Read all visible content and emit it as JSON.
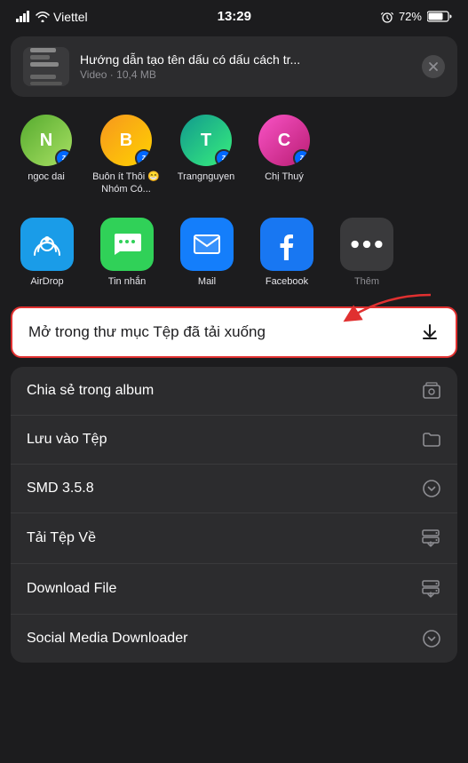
{
  "statusBar": {
    "carrier": "Viettel",
    "time": "13:29",
    "battery": "72%"
  },
  "notification": {
    "title": "Hướng dẫn tạo tên dấu có dấu cách tr...",
    "subtitle": "Video · 10,4 MB",
    "closeLabel": "×"
  },
  "contacts": [
    {
      "id": "c1",
      "name": "ngoc dai",
      "initials": "N",
      "color": "green"
    },
    {
      "id": "c2",
      "name": "Buôn ít Thôi 😁 Nhóm Có...",
      "initials": "B",
      "color": "orange"
    },
    {
      "id": "c3",
      "name": "Trangnguyen",
      "initials": "T",
      "color": "teal"
    },
    {
      "id": "c4",
      "name": "Chị Thuý",
      "initials": "C",
      "color": "pink"
    }
  ],
  "apps": [
    {
      "id": "airdrop",
      "label": "AirDrop",
      "iconClass": "airdrop"
    },
    {
      "id": "messages",
      "label": "Tin nhắn",
      "iconClass": "messages"
    },
    {
      "id": "mail",
      "label": "Mail",
      "iconClass": "mail"
    },
    {
      "id": "facebook",
      "label": "Facebook",
      "iconClass": "facebook"
    }
  ],
  "actions": [
    {
      "id": "open-downloads",
      "label": "Mở trong thư mục Tệp đã tải xuống",
      "highlighted": true,
      "iconType": "download"
    },
    {
      "id": "share-album",
      "label": "Chia sẻ trong album",
      "highlighted": false,
      "iconType": "album"
    },
    {
      "id": "save-file",
      "label": "Lưu vào Tệp",
      "highlighted": false,
      "iconType": "folder"
    },
    {
      "id": "smd",
      "label": "SMD 3.5.8",
      "highlighted": false,
      "iconType": "chevron-down"
    },
    {
      "id": "tai-tep-ve",
      "label": "Tải Tệp Về",
      "highlighted": false,
      "iconType": "download-app"
    },
    {
      "id": "download-file",
      "label": "Download File",
      "highlighted": false,
      "iconType": "download-app"
    },
    {
      "id": "social-media-downloader",
      "label": "Social Media Downloader",
      "highlighted": false,
      "iconType": "chevron-down"
    }
  ]
}
